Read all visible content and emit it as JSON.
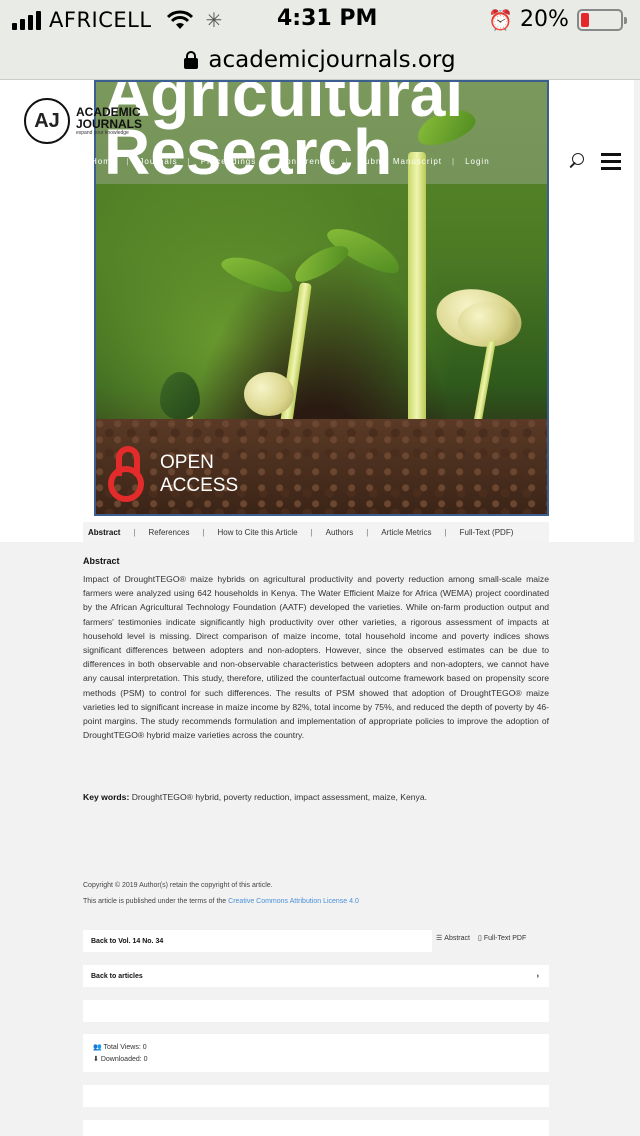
{
  "status_bar": {
    "carrier": "AFRICELL",
    "time": "4:31 PM",
    "battery_percent": "20%",
    "battery_level": 0.2
  },
  "browser": {
    "url": "academicjournals.org"
  },
  "logo": {
    "mark": "AJ",
    "name_line1": "ACADEMIC",
    "name_line2": "JOURNALS",
    "tagline": "expand your knowledge"
  },
  "nav": {
    "items": [
      "Home",
      "Journals",
      "Proceedings",
      "Conferences",
      "Submit Manuscript",
      "Login"
    ]
  },
  "cover": {
    "title_line1": "Agricultural",
    "title_line2": "Research",
    "badge_line1": "OPEN",
    "badge_line2": "ACCESS"
  },
  "tabs": [
    "Abstract",
    "References",
    "How to Cite this Article",
    "Authors",
    "Article Metrics",
    "Full-Text (PDF)"
  ],
  "abstract": {
    "heading": "Abstract",
    "text": "Impact of DroughtTEGO® maize hybrids on agricultural productivity and poverty reduction among small-scale maize farmers were analyzed using 642 households in Kenya. The Water Efficient Maize for Africa (WEMA) project coordinated by the African Agricultural Technology Foundation (AATF) developed the varieties. While on-farm production output and farmers' testimonies indicate significantly high productivity over other varieties, a rigorous assessment of impacts at household level is missing. Direct comparison of maize income, total household income and poverty indices shows significant differences between adopters and non-adopters. However, since the observed estimates can be due to differences in both observable and non-observable characteristics between adopters and non-adopters, we cannot have any causal interpretation. This study, therefore, utilized the counterfactual outcome framework based on propensity score methods (PSM) to control for such differences. The results of PSM showed that adoption of DroughtTEGO® maize varieties led to significant increase in maize income by 82%, total income by 75%, and reduced the depth of poverty by 46-point margins. The study recommends formulation and implementation of appropriate policies to improve the adoption of DroughtTEGO® hybrid maize varieties across the country."
  },
  "keywords": {
    "label": "Key words:",
    "text": "DroughtTEGO® hybrid, poverty reduction, impact assessment, maize, Kenya."
  },
  "copyright": {
    "line1": "Copyright © 2019 Author(s) retain the copyright of this article.",
    "line2_prefix": "This article is published under the terms of the ",
    "license_link": "Creative Commons Attribution License 4.0"
  },
  "links": {
    "back_to_volume": "Back to Vol. 14 No. 34",
    "abstract_link": "Abstract",
    "fulltext_link": "Full-Text PDF",
    "back_to_articles": "Back to articles",
    "chevron": "›"
  },
  "stats": {
    "total_views": "Total Views: 0",
    "downloaded": "Downloaded: 0"
  },
  "icons": [
    "lock-icon",
    "search-icon",
    "menu-icon",
    "list-icon",
    "pdf-icon",
    "users-icon",
    "download-icon",
    "open-access-icon",
    "alarm-icon",
    "wifi-icon"
  ]
}
